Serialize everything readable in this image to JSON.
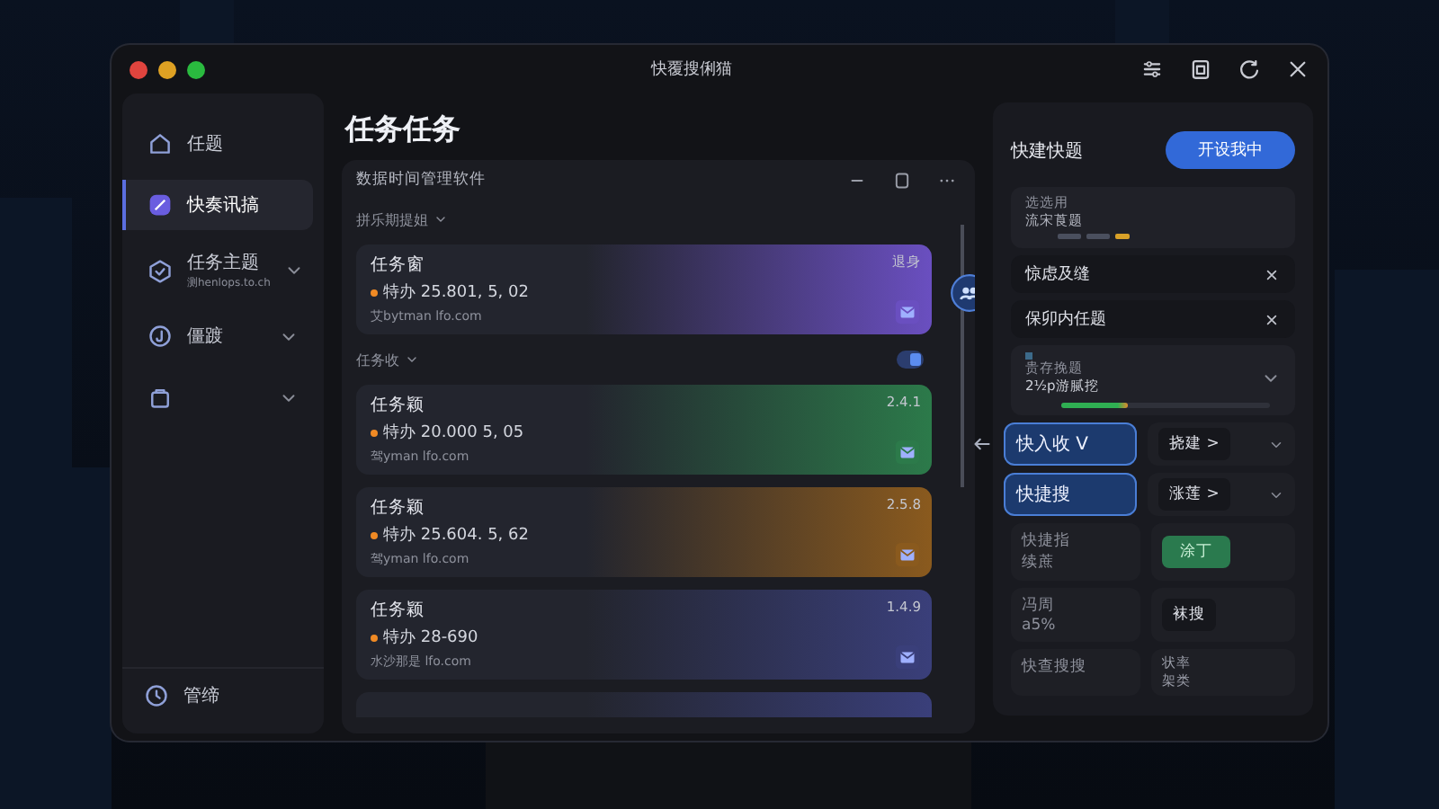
{
  "window": {
    "title": "快覆搜俐猫"
  },
  "sidebar": {
    "items": [
      {
        "kind": "link",
        "label": "任题",
        "selected": false
      },
      {
        "kind": "link",
        "label": "快奏讯搞",
        "selected": true
      },
      {
        "kind": "group",
        "label": "任务主题",
        "sub": "测henlops.to.ch",
        "selected": false
      },
      {
        "kind": "group",
        "label": "僵踱",
        "selected": false
      },
      {
        "kind": "group",
        "selected": false
      }
    ],
    "footer": {
      "label": "管缔"
    }
  },
  "main": {
    "title": "任务任务",
    "toolbar": {
      "label": "数据时间管理软件"
    },
    "list": [
      {
        "kind": "group",
        "label": "拼乐期提姐"
      },
      {
        "kind": "card",
        "title": "任务窗",
        "value": "特办 25.801, 5, 02",
        "sub": "艾bytman lfo.com",
        "tag": "退身",
        "color": "#6a4fc0"
      },
      {
        "kind": "group_toggle",
        "label": "任务收"
      },
      {
        "kind": "card",
        "title": "任务颖",
        "value": "特办 20.000 5, 05",
        "sub": "驾yman lfo.com",
        "tag": "2.4.1",
        "color": "#2c7a4a"
      },
      {
        "kind": "card",
        "title": "任务颖",
        "value": "特办 25.604. 5, 62",
        "sub": "驾yman lfo.com",
        "tag": "2.5.8",
        "color": "#8a5a1e"
      },
      {
        "kind": "card",
        "title": "任务颖",
        "value": "特办 28-690",
        "sub": "水沙那是 lfo.com",
        "tag": "1.4.9",
        "color": "#3a3f7a"
      },
      {
        "kind": "stub",
        "color": "#3a3f7a"
      }
    ]
  },
  "panel": {
    "title": "快建快题",
    "button": "开设我中",
    "block_1": {
      "lines": [
        "选选用",
        "流宋莨题"
      ]
    },
    "chips": [
      {
        "label": "惊虑及缝"
      },
      {
        "label": "保卯内任题"
      }
    ],
    "block_2": {
      "lines": [
        "贵存挽题",
        "2½p游腻挖"
      ],
      "level": 0.32
    },
    "rows": [
      {
        "selected": true,
        "left": [
          "快入收 V"
        ],
        "right": {
          "kind": "chip",
          "lines": [
            "挠建 >"
          ]
        }
      },
      {
        "selected": true,
        "left": [
          "快捷搜"
        ],
        "right": {
          "kind": "chip",
          "lines": [
            "涨莲 >"
          ]
        }
      },
      {
        "selected": false,
        "left": [
          "快捷指",
          "续蔗"
        ],
        "right": {
          "kind": "action",
          "lines": [
            "涂丁"
          ]
        }
      },
      {
        "selected": false,
        "left": [
          "冯周",
          "a5%"
        ],
        "right": {
          "kind": "chip",
          "lines": [
            "袜搜"
          ]
        }
      },
      {
        "selected": false,
        "left": [
          "快查搜搜"
        ],
        "right": {
          "kind": "plain",
          "lines": [
            "状率",
            "架类"
          ]
        }
      }
    ]
  }
}
